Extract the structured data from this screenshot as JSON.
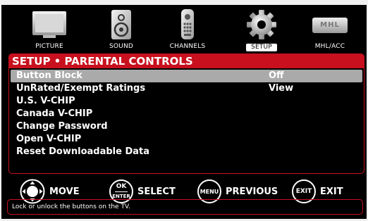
{
  "nav": [
    {
      "label": "PICTURE",
      "icon": "picture-icon",
      "active": false
    },
    {
      "label": "SOUND",
      "icon": "speaker-icon",
      "active": false
    },
    {
      "label": "CHANNELS",
      "icon": "remote-icon",
      "active": false
    },
    {
      "label": "SETUP",
      "icon": "gear-icon",
      "active": true
    },
    {
      "label": "MHL/ACC",
      "icon": "mhl-logo",
      "active": false
    }
  ],
  "mhl_logo_text": "MHL",
  "menu": {
    "title": "SETUP • PARENTAL CONTROLS",
    "items": [
      {
        "label": "Button Block",
        "value": "Off",
        "selected": true
      },
      {
        "label": "UnRated/Exempt Ratings",
        "value": "View",
        "selected": false
      },
      {
        "label": "U.S. V-CHIP",
        "value": "",
        "selected": false
      },
      {
        "label": "Canada V-CHIP",
        "value": "",
        "selected": false
      },
      {
        "label": "Change Password",
        "value": "",
        "selected": false
      },
      {
        "label": "Open V-CHIP",
        "value": "",
        "selected": false
      },
      {
        "label": "Reset Downloadable Data",
        "value": "",
        "selected": false
      }
    ]
  },
  "controls": {
    "move": {
      "label": "MOVE"
    },
    "select": {
      "label": "SELECT",
      "button_top": "OK",
      "button_bottom": "ENTER"
    },
    "previous": {
      "label": "PREVIOUS",
      "button": "MENU"
    },
    "exit": {
      "label": "EXIT",
      "button": "EXIT"
    }
  },
  "help_text": "Lock or unlock the buttons on the TV.",
  "colors": {
    "accent": "#c8101e",
    "background": "#000000",
    "selected_row": "#aaaaaa"
  }
}
